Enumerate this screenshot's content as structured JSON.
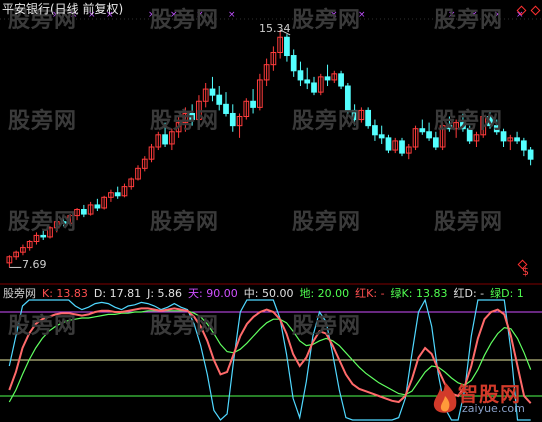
{
  "header": {
    "title": "平安银行(日线 前复权)"
  },
  "price_chart": {
    "high_label": "15.34",
    "low_label": "7.69",
    "colors": {
      "up": "#ff3c3c",
      "down": "#54ffff",
      "marker": "#c050ff",
      "wick": "#ff3c3c"
    },
    "candles": [
      [
        7.7,
        7.95,
        7.55,
        7.9
      ],
      [
        7.9,
        8.1,
        7.8,
        8.05
      ],
      [
        8.05,
        8.3,
        7.95,
        8.2
      ],
      [
        8.2,
        8.45,
        8.1,
        8.4
      ],
      [
        8.4,
        8.7,
        8.3,
        8.6
      ],
      [
        8.6,
        8.8,
        8.45,
        8.55
      ],
      [
        8.55,
        8.9,
        8.5,
        8.85
      ],
      [
        8.85,
        9.1,
        8.7,
        9.05
      ],
      [
        9.05,
        9.2,
        8.9,
        9.0
      ],
      [
        9.0,
        9.3,
        8.95,
        9.25
      ],
      [
        9.25,
        9.5,
        9.1,
        9.45
      ],
      [
        9.45,
        9.6,
        9.2,
        9.3
      ],
      [
        9.3,
        9.7,
        9.25,
        9.6
      ],
      [
        9.6,
        9.8,
        9.4,
        9.5
      ],
      [
        9.5,
        9.9,
        9.45,
        9.85
      ],
      [
        9.85,
        10.1,
        9.7,
        10.0
      ],
      [
        10.0,
        10.2,
        9.8,
        9.9
      ],
      [
        9.9,
        10.3,
        9.85,
        10.2
      ],
      [
        10.2,
        10.5,
        10.1,
        10.45
      ],
      [
        10.45,
        10.9,
        10.4,
        10.8
      ],
      [
        10.8,
        11.2,
        10.7,
        11.1
      ],
      [
        11.1,
        11.6,
        11.0,
        11.5
      ],
      [
        11.5,
        12.0,
        11.4,
        11.9
      ],
      [
        11.9,
        12.3,
        11.5,
        11.6
      ],
      [
        11.6,
        12.1,
        11.4,
        12.0
      ],
      [
        12.0,
        12.5,
        11.8,
        12.3
      ],
      [
        12.3,
        12.8,
        12.0,
        12.6
      ],
      [
        12.6,
        12.9,
        12.2,
        12.4
      ],
      [
        12.4,
        13.2,
        12.3,
        13.0
      ],
      [
        13.0,
        13.6,
        12.8,
        13.4
      ],
      [
        13.4,
        13.8,
        13.0,
        13.2
      ],
      [
        13.2,
        13.5,
        12.7,
        12.9
      ],
      [
        12.9,
        13.3,
        12.5,
        12.6
      ],
      [
        12.6,
        12.9,
        12.0,
        12.2
      ],
      [
        12.2,
        12.6,
        11.8,
        12.5
      ],
      [
        12.5,
        13.1,
        12.4,
        13.0
      ],
      [
        13.0,
        13.4,
        12.6,
        12.8
      ],
      [
        12.8,
        13.9,
        12.7,
        13.7
      ],
      [
        13.7,
        14.4,
        13.5,
        14.2
      ],
      [
        14.2,
        14.8,
        14.0,
        14.6
      ],
      [
        14.6,
        15.34,
        14.4,
        15.1
      ],
      [
        15.1,
        15.2,
        14.3,
        14.5
      ],
      [
        14.5,
        14.7,
        13.8,
        14.0
      ],
      [
        14.0,
        14.3,
        13.5,
        13.7
      ],
      [
        13.7,
        14.1,
        13.4,
        13.6
      ],
      [
        13.6,
        13.8,
        13.2,
        13.3
      ],
      [
        13.3,
        13.9,
        13.2,
        13.8
      ],
      [
        13.8,
        14.2,
        13.5,
        13.7
      ],
      [
        13.7,
        14.0,
        13.6,
        13.9
      ],
      [
        13.9,
        14.0,
        13.4,
        13.5
      ],
      [
        13.5,
        13.6,
        12.5,
        12.7
      ],
      [
        12.7,
        12.9,
        12.2,
        12.4
      ],
      [
        12.4,
        12.8,
        12.3,
        12.7
      ],
      [
        12.7,
        12.8,
        12.1,
        12.2
      ],
      [
        12.2,
        12.4,
        11.7,
        11.9
      ],
      [
        11.9,
        12.2,
        11.6,
        11.8
      ],
      [
        11.8,
        11.9,
        11.3,
        11.4
      ],
      [
        11.4,
        11.8,
        11.3,
        11.7
      ],
      [
        11.7,
        11.8,
        11.2,
        11.3
      ],
      [
        11.3,
        11.6,
        11.1,
        11.5
      ],
      [
        11.5,
        12.2,
        11.4,
        12.1
      ],
      [
        12.1,
        12.4,
        11.9,
        12.0
      ],
      [
        12.0,
        12.3,
        11.7,
        11.8
      ],
      [
        11.8,
        12.0,
        11.4,
        11.5
      ],
      [
        11.5,
        12.3,
        11.4,
        12.2
      ],
      [
        12.2,
        12.5,
        12.0,
        12.1
      ],
      [
        12.1,
        12.4,
        11.8,
        12.3
      ],
      [
        12.3,
        12.6,
        12.0,
        12.1
      ],
      [
        12.1,
        12.2,
        11.6,
        11.7
      ],
      [
        11.7,
        12.0,
        11.5,
        11.9
      ],
      [
        11.9,
        12.6,
        11.8,
        12.5
      ],
      [
        12.5,
        12.7,
        12.1,
        12.2
      ],
      [
        12.2,
        12.4,
        11.9,
        12.0
      ],
      [
        12.0,
        12.1,
        11.5,
        11.7
      ],
      [
        11.7,
        11.9,
        11.4,
        11.8
      ],
      [
        11.8,
        12.0,
        11.6,
        11.7
      ],
      [
        11.7,
        11.8,
        11.2,
        11.4
      ],
      [
        11.4,
        11.5,
        10.9,
        11.1
      ]
    ],
    "ylim": [
      7.4,
      15.6
    ]
  },
  "indicator": {
    "name": "股旁网",
    "legend": [
      {
        "text": "K: 13.83",
        "color": "#ff5050"
      },
      {
        "text": "D: 17.81",
        "color": "#e0e0e0"
      },
      {
        "text": "J: 5.86",
        "color": "#e0e0e0"
      },
      {
        "text": "天: 90.00",
        "color": "#d050ff"
      },
      {
        "text": "中: 50.00",
        "color": "#e0e0e0"
      },
      {
        "text": "地: 20.00",
        "color": "#50ff50"
      },
      {
        "text": "红K: -",
        "color": "#ff5050"
      },
      {
        "text": "绿K: 13.83",
        "color": "#50ff50"
      },
      {
        "text": "红D: -",
        "color": "#e0e0e0"
      },
      {
        "text": "绿D: 1",
        "color": "#50ff50"
      }
    ],
    "ylim": [
      0,
      100
    ],
    "levels": {
      "sky": 90,
      "mid": 50,
      "ground": 20
    },
    "level_colors": {
      "sky": "#d050ff",
      "mid": "#e8e8a0",
      "ground": "#50ff50"
    },
    "series": {
      "K": [
        25,
        40,
        60,
        72,
        80,
        84,
        86,
        88,
        89,
        89,
        88,
        87,
        88,
        90,
        91,
        91,
        90,
        90,
        91,
        92,
        93,
        93,
        92,
        91,
        92,
        93,
        92,
        91,
        86,
        78,
        66,
        50,
        38,
        40,
        55,
        70,
        80,
        86,
        90,
        92,
        90,
        84,
        72,
        55,
        45,
        52,
        65,
        74,
        72,
        62,
        50,
        38,
        30,
        26,
        24,
        22,
        20,
        18,
        16,
        15,
        20,
        34,
        52,
        60,
        55,
        42,
        30,
        22,
        20,
        28,
        45,
        68,
        84,
        90,
        92,
        88,
        70,
        45,
        20,
        14
      ],
      "D": [
        15,
        25,
        38,
        50,
        60,
        68,
        74,
        78,
        81,
        83,
        84,
        85,
        85,
        86,
        87,
        88,
        88,
        89,
        89,
        90,
        90,
        91,
        91,
        91,
        91,
        91,
        91,
        91,
        89,
        86,
        80,
        72,
        63,
        57,
        56,
        59,
        64,
        70,
        76,
        81,
        84,
        84,
        81,
        74,
        66,
        62,
        63,
        66,
        68,
        66,
        62,
        56,
        50,
        44,
        39,
        35,
        31,
        28,
        25,
        22,
        21,
        24,
        32,
        40,
        45,
        44,
        40,
        35,
        31,
        29,
        33,
        42,
        54,
        64,
        72,
        77,
        76,
        68,
        56,
        42
      ],
      "J": [
        45,
        70,
        95,
        100,
        100,
        100,
        100,
        100,
        100,
        100,
        95,
        92,
        94,
        97,
        98,
        97,
        94,
        92,
        95,
        96,
        98,
        97,
        95,
        92,
        94,
        97,
        94,
        92,
        80,
        62,
        38,
        8,
        0,
        5,
        50,
        90,
        100,
        100,
        100,
        100,
        100,
        85,
        55,
        18,
        2,
        32,
        70,
        90,
        82,
        55,
        25,
        2,
        0,
        0,
        0,
        0,
        0,
        0,
        0,
        2,
        18,
        55,
        90,
        100,
        78,
        38,
        10,
        0,
        0,
        25,
        70,
        100,
        100,
        100,
        100,
        100,
        58,
        0,
        0,
        0
      ]
    },
    "series_colors": {
      "K": "#ff6a6a",
      "D": "#60ff60",
      "J": "#50d8ff"
    }
  },
  "watermark": {
    "text": "股旁网"
  },
  "logo": {
    "main": "智股网",
    "sub": "zaiyue.com"
  },
  "markers": {
    "dollar": "$"
  }
}
